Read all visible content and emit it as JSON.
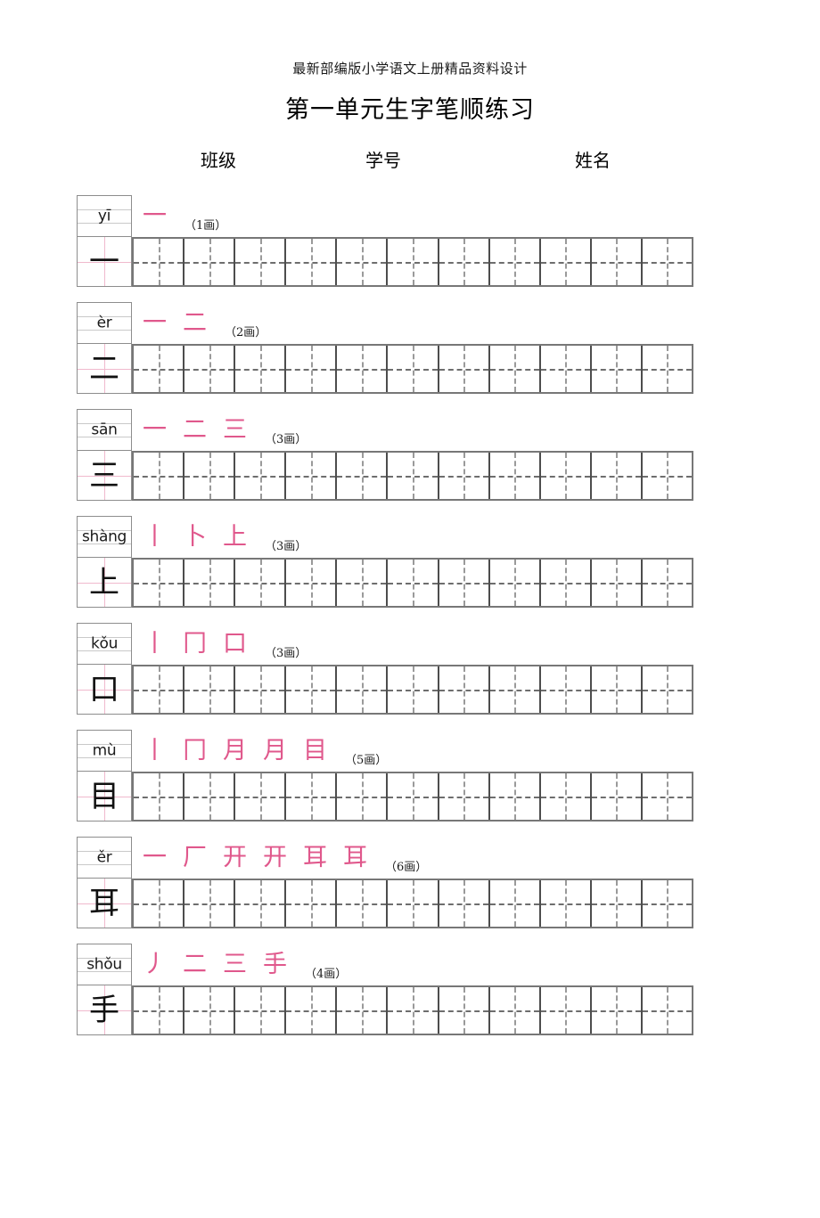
{
  "header": {
    "watermark": "最新部编版小学语文上册精品资料设计",
    "title": "第一单元生字笔顺练习",
    "fields": [
      {
        "label": "班级"
      },
      {
        "label": "学号"
      },
      {
        "label": "姓名"
      }
    ]
  },
  "grid": {
    "practice_cells_per_row": 11
  },
  "colors": {
    "stroke_demo": "#e0588c",
    "char_guide": "#f0b9cd",
    "grid_border": "#4d4d4d",
    "grid_dash": "#6e6e6e",
    "text": "#111111"
  },
  "rows": [
    {
      "pinyin": "yī",
      "character": "一",
      "stroke_count_label": "（1画）",
      "strokes": [
        "一"
      ]
    },
    {
      "pinyin": "èr",
      "character": "二",
      "stroke_count_label": "（2画）",
      "strokes": [
        "一",
        "二"
      ]
    },
    {
      "pinyin": "sān",
      "character": "三",
      "stroke_count_label": "（3画）",
      "strokes": [
        "一",
        "二",
        "三"
      ]
    },
    {
      "pinyin": "shàng",
      "character": "上",
      "stroke_count_label": "（3画）",
      "strokes": [
        "丨",
        "卜",
        "上"
      ]
    },
    {
      "pinyin": "kǒu",
      "character": "口",
      "stroke_count_label": "（3画）",
      "strokes": [
        "丨",
        "冂",
        "口"
      ]
    },
    {
      "pinyin": "mù",
      "character": "目",
      "stroke_count_label": "（5画）",
      "strokes": [
        "丨",
        "冂",
        "月",
        "月",
        "目"
      ]
    },
    {
      "pinyin": "ěr",
      "character": "耳",
      "stroke_count_label": "（6画）",
      "strokes": [
        "一",
        "厂",
        "开",
        "开",
        "耳",
        "耳"
      ]
    },
    {
      "pinyin": "shǒu",
      "character": "手",
      "stroke_count_label": "（4画）",
      "strokes": [
        "丿",
        "二",
        "三",
        "手"
      ]
    }
  ]
}
